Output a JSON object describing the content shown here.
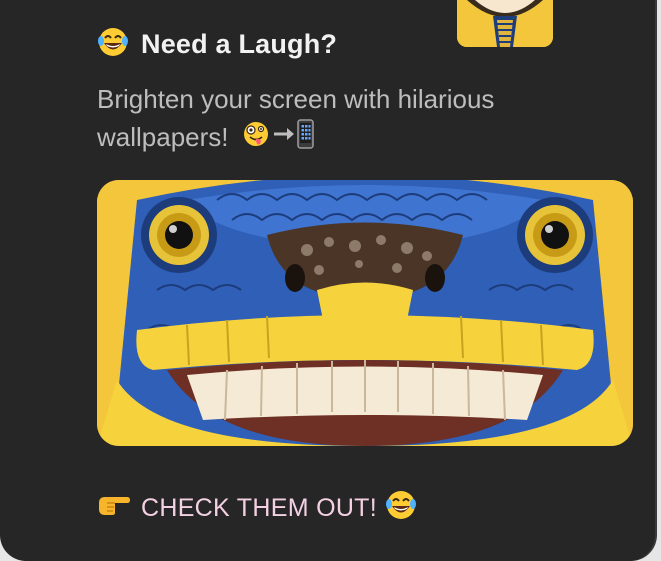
{
  "post": {
    "title": "Need a Laugh?",
    "subtitle": "Brighten your screen with hilarious wallpapers!",
    "cta": "CHECK THEM OUT!"
  },
  "icons": {
    "title_emoji": "laughing-tears-emoji",
    "subtitle_emoji_1": "zany-face-emoji",
    "subtitle_emoji_2": "arrow-to-phone-emoji",
    "cta_left": "pointing-hand-emoji",
    "cta_right": "laughing-tears-emoji"
  },
  "colors": {
    "card_bg": "#262626",
    "title": "#f2f2f2",
    "subtitle": "#bdbdbd",
    "cta": "#f4d0e3",
    "hero_bg": "#f3c63c",
    "creature_blue": "#2f5fb7",
    "creature_yellow": "#f6d23d"
  }
}
